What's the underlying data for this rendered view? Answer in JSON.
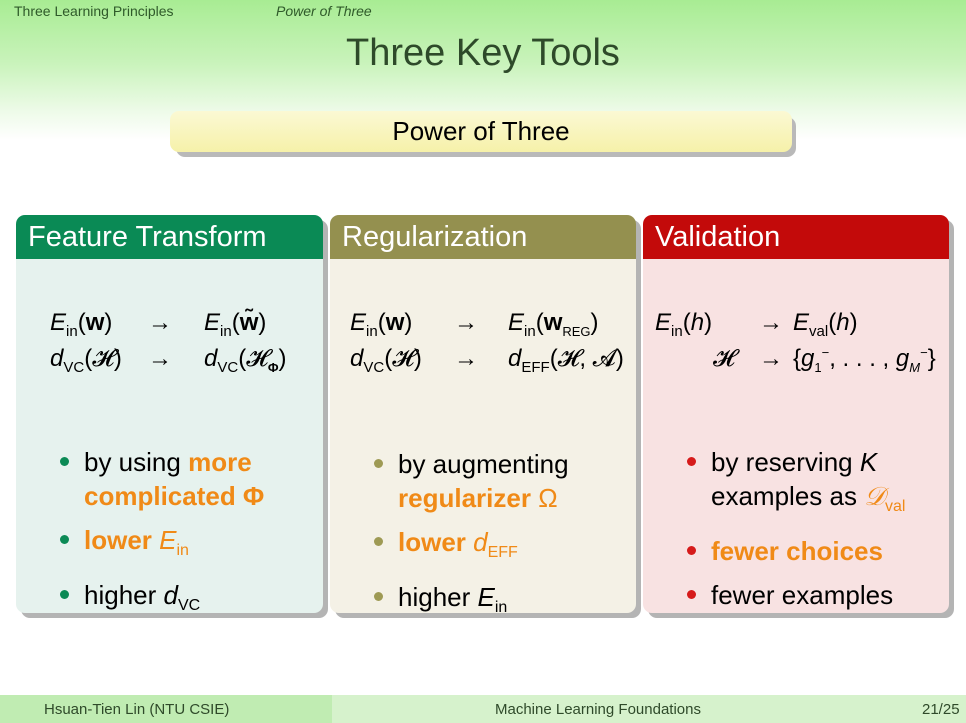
{
  "nav": {
    "section": "Three Learning Principles",
    "subsection": "Power of Three"
  },
  "title": "Three Key Tools",
  "banner": "Power of Three",
  "panels": [
    {
      "title": "Feature Transform",
      "rows": [
        {
          "left": "Ein(w)",
          "arrow": "→",
          "right": "Ein(w̃)"
        },
        {
          "left": "dVC(𝓗)",
          "arrow": "→",
          "right": "dVC(𝓗Φ)"
        }
      ],
      "bullets": [
        {
          "text": "by using ",
          "highlight": "more complicated Φ"
        },
        {
          "highlight": "lower Ein"
        },
        {
          "text": "higher dVC"
        }
      ]
    },
    {
      "title": "Regularization",
      "rows": [
        {
          "left": "Ein(w)",
          "arrow": "→",
          "right": "Ein(wREG)"
        },
        {
          "left": "dVC(𝓗)",
          "arrow": "→",
          "right": "dEFF(𝓗, 𝓐)"
        }
      ],
      "bullets": [
        {
          "text": "by augmenting ",
          "highlight": "regularizer Ω"
        },
        {
          "highlight": "lower dEFF"
        },
        {
          "text": "higher Ein"
        }
      ]
    },
    {
      "title": "Validation",
      "rows": [
        {
          "left": "Ein(h)",
          "arrow": "→",
          "right": "Eval(h)"
        },
        {
          "left": "𝓗",
          "arrow": "→",
          "right": "{g1⁻, . . . , gM⁻}"
        }
      ],
      "bullets": [
        {
          "text": "by reserving K examples as ",
          "highlight": "𝒟val"
        },
        {
          "highlight": "fewer choices"
        },
        {
          "text": "fewer examples"
        }
      ]
    }
  ],
  "footer": {
    "author": "Hsuan-Tien Lin (NTU CSIE)",
    "course": "Machine Learning Foundations",
    "page": "21/25"
  },
  "colors": {
    "feature_header": "#0a8a55",
    "regularization_header": "#94904f",
    "validation_header": "#c30a0a",
    "highlight": "#f08a17"
  }
}
